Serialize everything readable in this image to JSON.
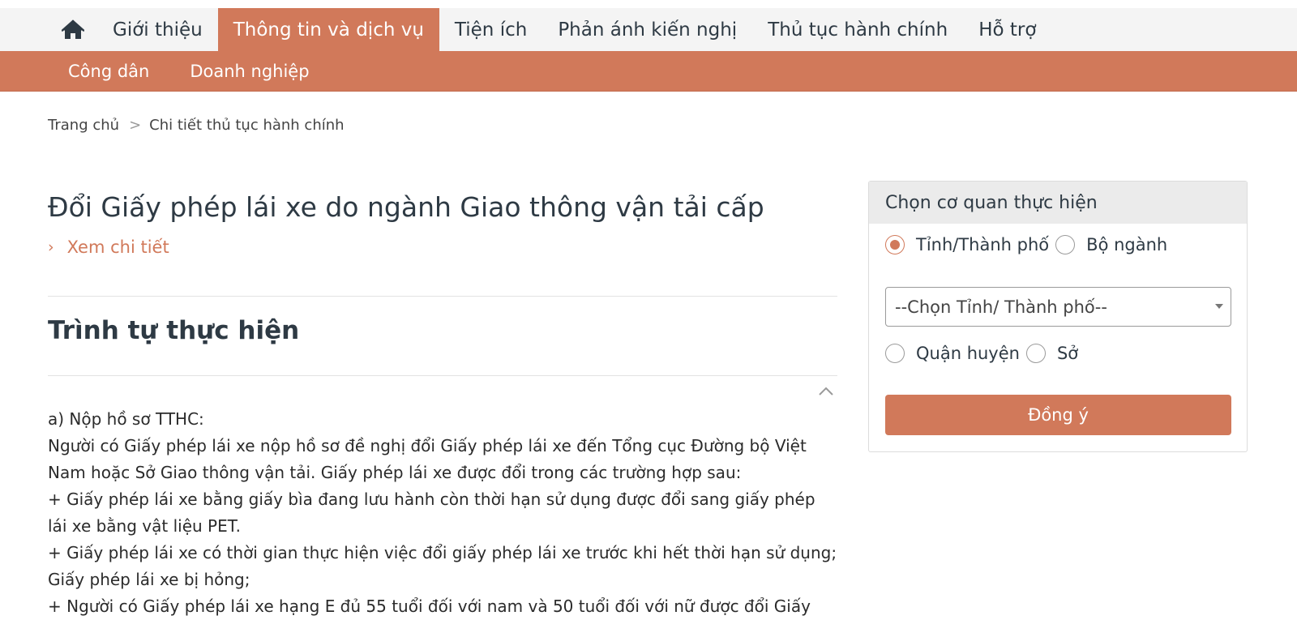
{
  "nav": {
    "items": [
      {
        "label": "Giới thiệu"
      },
      {
        "label": "Thông tin và dịch vụ"
      },
      {
        "label": "Tiện ích"
      },
      {
        "label": "Phản ánh kiến nghị"
      },
      {
        "label": "Thủ tục hành chính"
      },
      {
        "label": "Hỗ trợ"
      }
    ],
    "active_index": 1,
    "home_icon": "home-icon"
  },
  "subnav": {
    "items": [
      {
        "label": "Công dân"
      },
      {
        "label": "Doanh nghiệp"
      }
    ]
  },
  "breadcrumb": {
    "home": "Trang chủ",
    "separator": ">",
    "current": "Chi tiết thủ tục hành chính"
  },
  "main": {
    "title": "Đổi Giấy phép lái xe do ngành Giao thông vận tải cấp",
    "detail_link": "Xem chi tiết",
    "section_title": "Trình tự thực hiện",
    "content_lines": [
      "a) Nộp hồ sơ TTHC:",
      "Người có Giấy phép lái xe nộp hồ sơ đề nghị đổi Giấy phép lái xe đến Tổng cục Đường bộ Việt",
      "Nam hoặc Sở Giao thông vận tải. Giấy phép lái xe được đổi trong các trường hợp sau:",
      "+ Giấy phép lái xe bằng giấy bìa đang lưu hành còn thời hạn sử dụng được đổi sang giấy phép",
      "lái xe bằng vật liệu PET.",
      "+ Giấy phép lái xe có thời gian thực hiện việc đổi giấy phép lái xe trước khi hết thời hạn sử dụng;",
      "Giấy phép lái xe bị hỏng;",
      "+ Người có Giấy phép lái xe hạng E đủ 55 tuổi đối với nam và 50 tuổi đối với nữ được đổi Giấy"
    ]
  },
  "panel": {
    "title": "Chọn cơ quan thực hiện",
    "level_options": [
      {
        "label": "Tỉnh/Thành phố",
        "checked": true
      },
      {
        "label": "Bộ ngành",
        "checked": false
      }
    ],
    "select_value": "--Chọn Tỉnh/ Thành phố--",
    "unit_options": [
      {
        "label": "Quận huyện",
        "checked": false
      },
      {
        "label": "Sở",
        "checked": false
      }
    ],
    "submit_label": "Đồng ý"
  },
  "colors": {
    "accent": "#d1795a",
    "nav_bg": "#f4f4f4",
    "text_dark": "#2e3a44"
  }
}
